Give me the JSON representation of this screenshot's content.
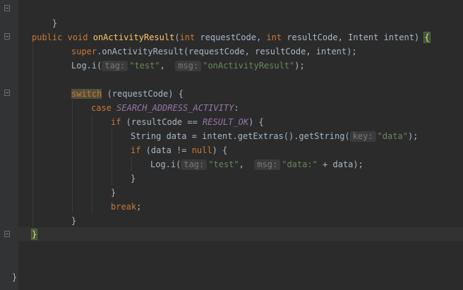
{
  "editor": {
    "lines": [
      {
        "id": "l1",
        "text": "}"
      },
      {
        "id": "l2",
        "kw1": "public",
        "kw2": "void",
        "fn": "onActivityResult",
        "p1": "(",
        "kw3": "int",
        "p2": " requestCode, ",
        "kw4": "int",
        "p3": " resultCode, Intent intent) ",
        "brace": "{"
      },
      {
        "id": "l3",
        "kw": "super",
        "rest": ".onActivityResult(requestCode, resultCode, intent);"
      },
      {
        "id": "l4",
        "pre": "Log.i(",
        "hint1": "tag:",
        "str1": "\"test\"",
        "mid": ",  ",
        "hint2": "msg:",
        "str2": "\"onActivityResult\"",
        "post": ");"
      },
      {
        "id": "l5",
        "kw": "switch",
        "rest": " (requestCode) {"
      },
      {
        "id": "l6",
        "kw": "case",
        "const": "SEARCH_ADDRESS_ACTIVITY",
        "rest": ":"
      },
      {
        "id": "l7",
        "kw": "if",
        "pre": " (resultCode == ",
        "const": "RESULT_OK",
        "rest": ") {"
      },
      {
        "id": "l8",
        "pre": "String data = intent.getExtras().getString(",
        "hint": "key:",
        "str": "\"data\"",
        "post": ");"
      },
      {
        "id": "l9",
        "kw1": "if",
        "pre": " (data != ",
        "kw2": "null",
        "post": ") {"
      },
      {
        "id": "l10",
        "pre": "Log.i(",
        "hint1": "tag:",
        "str1": "\"test\"",
        "mid": ",  ",
        "hint2": "msg:",
        "str2": "\"data:\"",
        "post": " + data);"
      },
      {
        "id": "l11",
        "text": "}"
      },
      {
        "id": "l12",
        "text": "}"
      },
      {
        "id": "l13",
        "kw": "break",
        "rest": ";"
      },
      {
        "id": "l14",
        "text": "}"
      },
      {
        "id": "l15",
        "text": "}"
      },
      {
        "id": "l16",
        "text": "}"
      }
    ]
  }
}
